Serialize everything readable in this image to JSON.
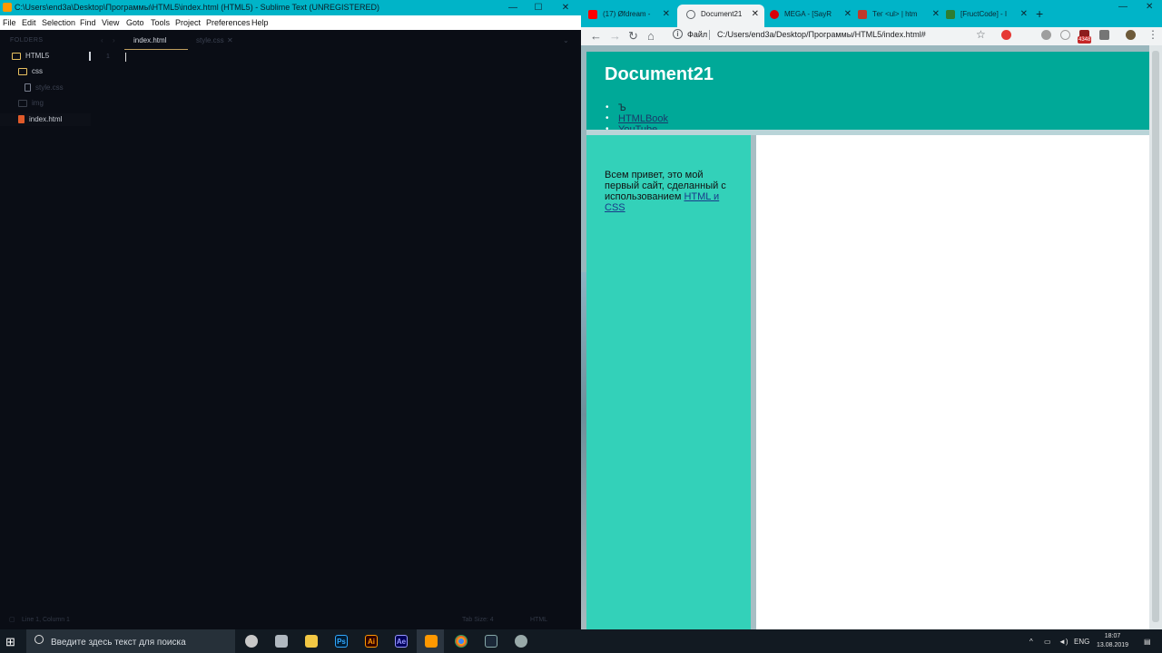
{
  "sublime": {
    "title": "C:\\Users\\end3a\\Desktop\\Программы\\HTML5\\index.html (HTML5) - Sublime Text (UNREGISTERED)",
    "menu": [
      "File",
      "Edit",
      "Selection",
      "Find",
      "View",
      "Goto",
      "Tools",
      "Project",
      "Preferences",
      "Help"
    ],
    "sidebar_header": "FOLDERS",
    "tree": [
      {
        "label": "HTML5",
        "icon": "folder-icon"
      },
      {
        "label": "css",
        "icon": "folder-icon"
      },
      {
        "label": "style.css",
        "icon": "file-icon"
      },
      {
        "label": "img",
        "icon": "folder-icon"
      },
      {
        "label": "index.html",
        "icon": "html-file-icon"
      }
    ],
    "tabs": [
      {
        "label": "index.html",
        "active": true
      },
      {
        "label": "style.css",
        "active": false
      }
    ],
    "line_number": "1",
    "status": {
      "position": "Line 1, Column 1",
      "tab_size": "Tab Size: 4",
      "syntax": "HTML"
    }
  },
  "chrome": {
    "tabs": [
      {
        "label": "(17) Øfdream -",
        "favicon_color": "#ff0000"
      },
      {
        "label": "Document21",
        "favicon_color": "#5f6368"
      },
      {
        "label": "MEGA - [SayR",
        "favicon_color": "#d90007"
      },
      {
        "label": "Тег <ul> | htm",
        "favicon_color": "#c0392b"
      },
      {
        "label": "[FructCode] - I",
        "favicon_color": "#2e7d32"
      }
    ],
    "url_scheme": "Файл",
    "url": "C:/Users/end3a/Desktop/Программы/HTML5/index.html#",
    "extension_badge": "4348"
  },
  "page": {
    "title": "Document21",
    "nav": [
      {
        "label": "Ъ",
        "link": false
      },
      {
        "label": "HTMLBook",
        "link": true
      },
      {
        "label": "YouTube",
        "link": true
      }
    ],
    "aside_text": "Всем привет, это мой первый сайт, сделанный с использованием ",
    "aside_link": "HTML и CSS",
    "colors": {
      "header": "#00a998",
      "aside": "#33d1b9",
      "main": "#ffffff"
    }
  },
  "taskbar": {
    "search_placeholder": "Введите здесь текст для поиска",
    "apps": [
      "cortana-icon",
      "mail-icon",
      "explorer-icon",
      "photoshop-icon",
      "illustrator-icon",
      "after-effects-icon",
      "sublime-icon",
      "chrome-icon",
      "steam-icon",
      "app-icon"
    ],
    "ps": "Ps",
    "ai": "Ai",
    "ae": "Ae",
    "lang": "ENG",
    "time": "18:07",
    "date": "13.08.2019"
  }
}
